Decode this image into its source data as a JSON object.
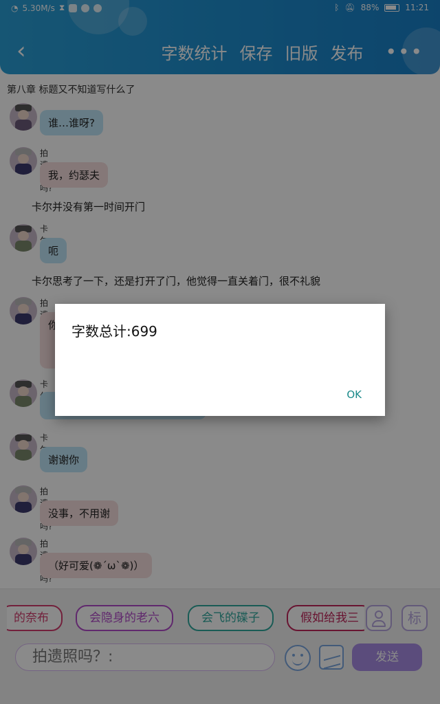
{
  "status_bar": {
    "speed": "5.30M/s",
    "battery": "88%",
    "time": "11:21"
  },
  "nav": {
    "actions": [
      "字数统计",
      "保存",
      "旧版",
      "发布"
    ],
    "more": "•••"
  },
  "chapter_title": "第八章   标题又不知道写什么了",
  "messages": [
    {
      "type": "bubble",
      "sender": "",
      "text": "谁…谁呀?",
      "color": "blue"
    },
    {
      "type": "bubble",
      "sender": "拍遗照吗?",
      "text": "我，约瑟夫",
      "color": "pink"
    },
    {
      "type": "narration",
      "text": "卡尔并没有第一时间开门"
    },
    {
      "type": "bubble",
      "sender": "卡尔",
      "text": "呃",
      "color": "blue"
    },
    {
      "type": "narration",
      "text": "卡尔思考了一下，还是打开了门，他觉得一直关着门，很不礼貌"
    },
    {
      "type": "bubble",
      "sender": "拍遗照吗?",
      "text": "你",
      "color": "pink"
    },
    {
      "type": "bubble",
      "sender": "卡尔",
      "text": "",
      "color": "blue"
    },
    {
      "type": "bubble",
      "sender": "卡尔",
      "text": "谢谢你",
      "color": "blue"
    },
    {
      "type": "bubble",
      "sender": "拍遗照吗?",
      "text": "没事，不用谢",
      "color": "pink"
    },
    {
      "type": "bubble",
      "sender": "拍遗照吗?",
      "text": "（好可爱(❁´ω`❁)）",
      "color": "pink"
    }
  ],
  "chips": [
    {
      "label": "的奈布",
      "color": "#d23c6e"
    },
    {
      "label": "会隐身的老六",
      "color": "#b24bc9"
    },
    {
      "label": "会飞的碟子",
      "color": "#2fa89e"
    },
    {
      "label": "假如给我三",
      "color": "#c0265b"
    }
  ],
  "side_buttons": {
    "tag_label": "标"
  },
  "input": {
    "placeholder": "拍遗照吗？:"
  },
  "send_label": "发送",
  "dialog": {
    "title": "字数总计:699",
    "ok_label": "OK"
  },
  "colors": {
    "header": "#1f8fd0",
    "send": "#a98de6",
    "dialog_ok": "#1a8a8a"
  }
}
